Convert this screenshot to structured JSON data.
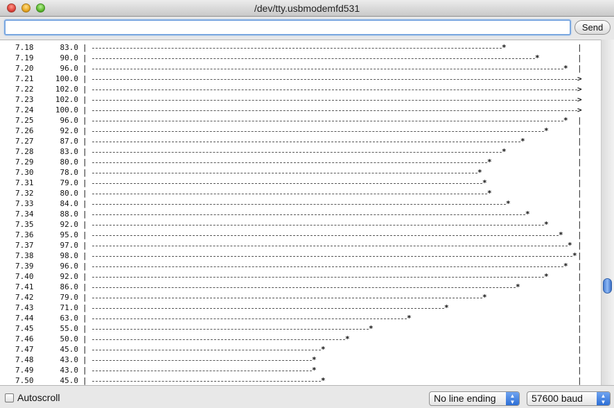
{
  "window": {
    "title": "/dev/tty.usbmodemfd531"
  },
  "toolbar": {
    "input_value": "",
    "send_label": "Send"
  },
  "serial": {
    "separator": "|",
    "rows": [
      {
        "time": "7.18",
        "value": "83.0"
      },
      {
        "time": "7.19",
        "value": "90.0"
      },
      {
        "time": "7.20",
        "value": "96.0"
      },
      {
        "time": "7.21",
        "value": "100.0"
      },
      {
        "time": "7.22",
        "value": "102.0"
      },
      {
        "time": "7.23",
        "value": "102.0"
      },
      {
        "time": "7.24",
        "value": "100.0"
      },
      {
        "time": "7.25",
        "value": "96.0"
      },
      {
        "time": "7.26",
        "value": "92.0"
      },
      {
        "time": "7.27",
        "value": "87.0"
      },
      {
        "time": "7.28",
        "value": "83.0"
      },
      {
        "time": "7.29",
        "value": "80.0"
      },
      {
        "time": "7.30",
        "value": "78.0"
      },
      {
        "time": "7.31",
        "value": "79.0"
      },
      {
        "time": "7.32",
        "value": "80.0"
      },
      {
        "time": "7.33",
        "value": "84.0"
      },
      {
        "time": "7.34",
        "value": "88.0"
      },
      {
        "time": "7.35",
        "value": "92.0"
      },
      {
        "time": "7.36",
        "value": "95.0"
      },
      {
        "time": "7.37",
        "value": "97.0"
      },
      {
        "time": "7.38",
        "value": "98.0"
      },
      {
        "time": "7.39",
        "value": "96.0"
      },
      {
        "time": "7.40",
        "value": "92.0"
      },
      {
        "time": "7.41",
        "value": "86.0"
      },
      {
        "time": "7.42",
        "value": "79.0"
      },
      {
        "time": "7.43",
        "value": "71.0"
      },
      {
        "time": "7.44",
        "value": "63.0"
      },
      {
        "time": "7.45",
        "value": "55.0"
      },
      {
        "time": "7.46",
        "value": "50.0"
      },
      {
        "time": "7.47",
        "value": "45.0"
      },
      {
        "time": "7.48",
        "value": "43.0"
      },
      {
        "time": "7.49",
        "value": "43.0"
      },
      {
        "time": "7.50",
        "value": "45.0"
      }
    ]
  },
  "statusbar": {
    "autoscroll_label": "Autoscroll",
    "autoscroll_checked": false,
    "line_ending": "No line ending",
    "baud": "57600 baud"
  },
  "icons": {
    "checkbox": "checkbox-icon",
    "dropdown": "updown-arrows-icon"
  }
}
